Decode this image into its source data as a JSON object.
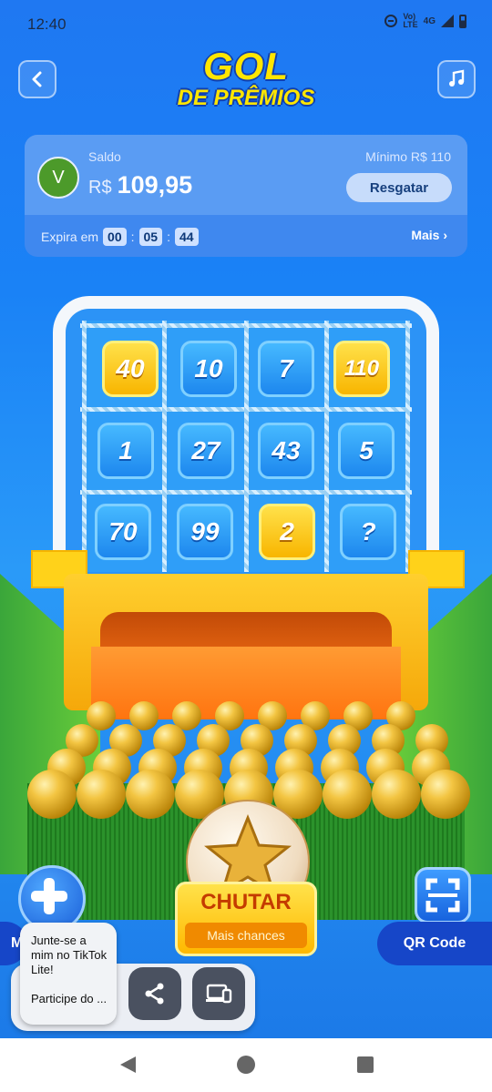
{
  "status_bar": {
    "time": "12:40",
    "network": "4G",
    "lte": "LTE"
  },
  "header": {
    "title_line1": "GOL",
    "title_line2": "DE PRÊMIOS"
  },
  "balance": {
    "avatar_letter": "V",
    "label": "Saldo",
    "currency": "R$",
    "amount": "109,95",
    "minimum": "Mínimo  R$ 110",
    "redeem_label": "Resgatar",
    "expires_label": "Expira em",
    "timer_h": "00",
    "timer_m": "05",
    "timer_s": "44",
    "more_label": "Mais ›"
  },
  "prize_grid": {
    "row1": [
      "40",
      "10",
      "7",
      "110"
    ],
    "row2": [
      "1",
      "27",
      "43",
      "5"
    ],
    "row3": [
      "70",
      "99",
      "2",
      "?"
    ]
  },
  "kick_button": {
    "label": "CHUTAR",
    "sub_label": "Mais chances"
  },
  "qr_button": {
    "label": "QR Code"
  },
  "left_button": {
    "label": "M"
  },
  "share_popup": {
    "message": "Junte-se a mim no TikTok Lite!",
    "participate": "Participe do ..."
  },
  "colors": {
    "gold_tile": "#ffc400",
    "blue_tile": "#2a9af6",
    "card": "#4f93f0",
    "kick": "#ffd12a"
  }
}
